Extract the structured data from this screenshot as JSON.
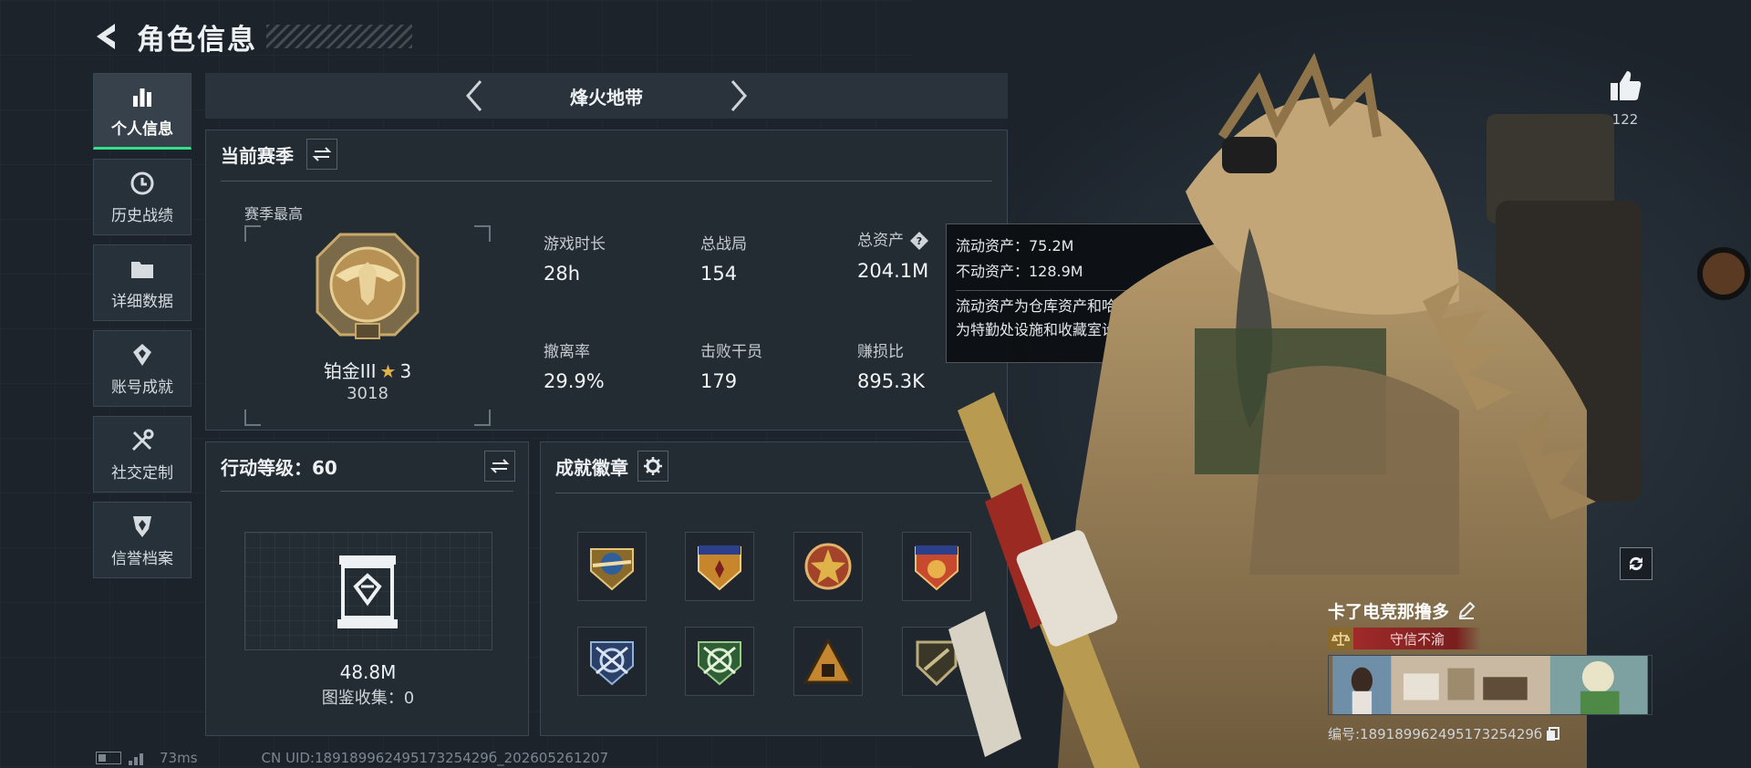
{
  "header": {
    "title": "角色信息"
  },
  "sidebar": {
    "items": [
      {
        "label": "个人信息",
        "icon": "bar-chart-icon",
        "active": true
      },
      {
        "label": "历史战绩",
        "icon": "clock-icon"
      },
      {
        "label": "详细数据",
        "icon": "folder-icon"
      },
      {
        "label": "账号成就",
        "icon": "achievement-icon"
      },
      {
        "label": "社交定制",
        "icon": "tools-icon"
      },
      {
        "label": "信誉档案",
        "icon": "shield-icon"
      }
    ]
  },
  "mode": {
    "name": "烽火地带"
  },
  "season": {
    "title": "当前赛季",
    "peak_label": "赛季最高",
    "rank_name": "铂金III",
    "rank_stars": "3",
    "rank_score": "3018",
    "stats": [
      {
        "label": "游戏时长",
        "value": "28h"
      },
      {
        "label": "总战局",
        "value": "154"
      },
      {
        "label": "总资产",
        "value": "204.1M"
      },
      {
        "label": "撤离率",
        "value": "29.9%"
      },
      {
        "label": "击败干员",
        "value": "179"
      },
      {
        "label": "赚损比",
        "value": "895.3K"
      }
    ]
  },
  "tooltip": {
    "liquid": "流动资产：75.2M",
    "fixed": "不动资产：128.9M",
    "desc_line1": "流动资产为仓库资产和哈夫币，不动资产",
    "desc_line2": "为特勤处设施和收藏室设施"
  },
  "level": {
    "title": "行动等级：60",
    "value": "48.8M",
    "collection": "图鉴收集：0"
  },
  "badges": {
    "title": "成就徽章",
    "colors": [
      "#c9a24a",
      "#d0662c",
      "#b8462a",
      "#c74a2e",
      "#5a7fa6",
      "#3f8a4a",
      "#c4862e",
      "#a89a6a"
    ]
  },
  "like": {
    "count": "122"
  },
  "profile": {
    "name": "卡了电竞那撸多",
    "reputation": "守信不渝",
    "uid": "编号:18918996249517325429б"
  },
  "footer": {
    "ping": "73ms",
    "uid": "CN UID:18918996249517325429б_202605261207"
  },
  "colors": {
    "accent": "#35e08a",
    "background": "#1c232b",
    "panel": "#242c34"
  }
}
